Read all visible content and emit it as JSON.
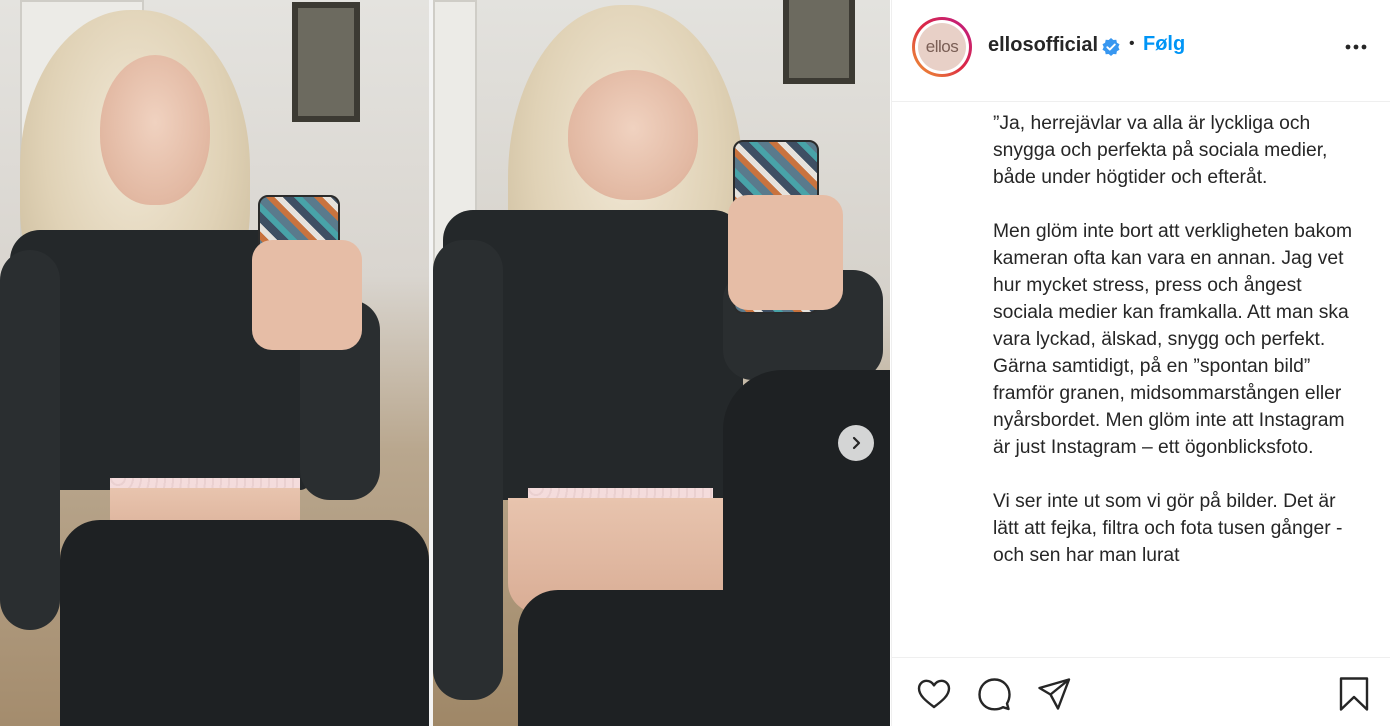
{
  "post": {
    "username": "ellosofficial",
    "avatar_text": "ellos",
    "separator": "•",
    "follow_label": "Følg",
    "caption": [
      "”Ja, herrejävlar va alla är lyckliga och snygga och perfekta på sociala medier, både under högtider och efteråt.",
      "Men glöm inte bort att verkligheten bakom kameran ofta kan vara en annan. Jag vet hur mycket stress, press och ångest sociala medier kan framkalla. Att man ska vara lyckad, älskad, snygg och perfekt. Gärna samtidigt, på en ”spontan bild” framför granen, midsommarstången eller nyårsbordet. Men glöm inte att Instagram är just Instagram – ett ögonblicksfoto.",
      "Vi ser inte ut som vi gör på bilder. Det är lätt att fejka, filtra och fota tusen gånger - och sen har man lurat"
    ]
  },
  "icons": {
    "verified": "verified-badge-icon",
    "more": "more-options-icon",
    "next": "chevron-right-icon",
    "like": "heart-icon",
    "comment": "comment-icon",
    "share": "share-icon",
    "save": "bookmark-icon"
  },
  "colors": {
    "accent": "#0095f6",
    "text": "#262626",
    "border": "#efefef"
  }
}
